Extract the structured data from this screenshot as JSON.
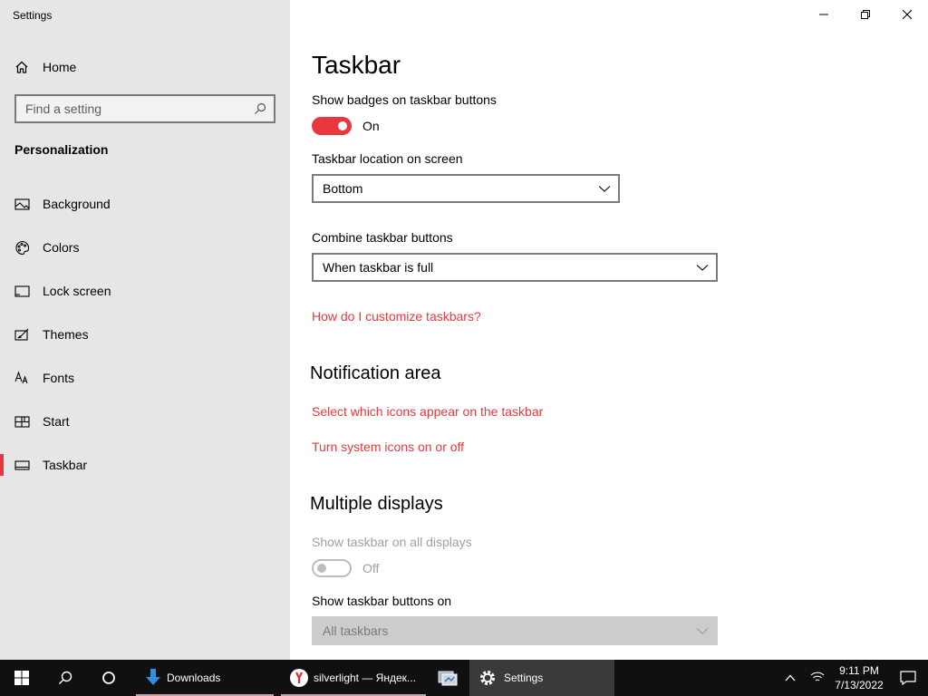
{
  "window": {
    "title": "Settings",
    "controls": [
      "minimize",
      "restore",
      "close"
    ]
  },
  "sidebar": {
    "home_label": "Home",
    "search_placeholder": "Find a setting",
    "section_label": "Personalization",
    "items": [
      {
        "label": "Background",
        "icon": "picture-icon"
      },
      {
        "label": "Colors",
        "icon": "palette-icon"
      },
      {
        "label": "Lock screen",
        "icon": "lock-screen-icon"
      },
      {
        "label": "Themes",
        "icon": "themes-icon"
      },
      {
        "label": "Fonts",
        "icon": "fonts-icon"
      },
      {
        "label": "Start",
        "icon": "start-icon"
      },
      {
        "label": "Taskbar",
        "icon": "taskbar-icon",
        "active": true
      }
    ]
  },
  "main": {
    "title": "Taskbar",
    "badges_label": "Show badges on taskbar buttons",
    "badges_state": "On",
    "location_label": "Taskbar location on screen",
    "location_value": "Bottom",
    "combine_label": "Combine taskbar buttons",
    "combine_value": "When taskbar is full",
    "customize_link": "How do I customize taskbars?",
    "notification_heading": "Notification area",
    "notif_link_1": "Select which icons appear on the taskbar",
    "notif_link_2": "Turn system icons on or off",
    "multi_heading": "Multiple displays",
    "show_all_label": "Show taskbar on all displays",
    "show_all_state": "Off",
    "buttons_on_label": "Show taskbar buttons on",
    "buttons_on_value": "All taskbars"
  },
  "taskbar": {
    "apps": [
      {
        "label": "Downloads",
        "icon": "download-arrow-icon"
      },
      {
        "label": "silverlight — Яндек...",
        "icon": "yandex-browser-icon"
      },
      {
        "label": "",
        "icon": "control-panel-icon"
      },
      {
        "label": "Settings",
        "icon": "gear-icon",
        "active": true
      }
    ],
    "time": "9:11 PM",
    "date": "7/13/2022"
  },
  "colors": {
    "accent": "#e8383d",
    "sidebar_bg": "#e6e6e6",
    "taskbar_bg": "#101010"
  }
}
